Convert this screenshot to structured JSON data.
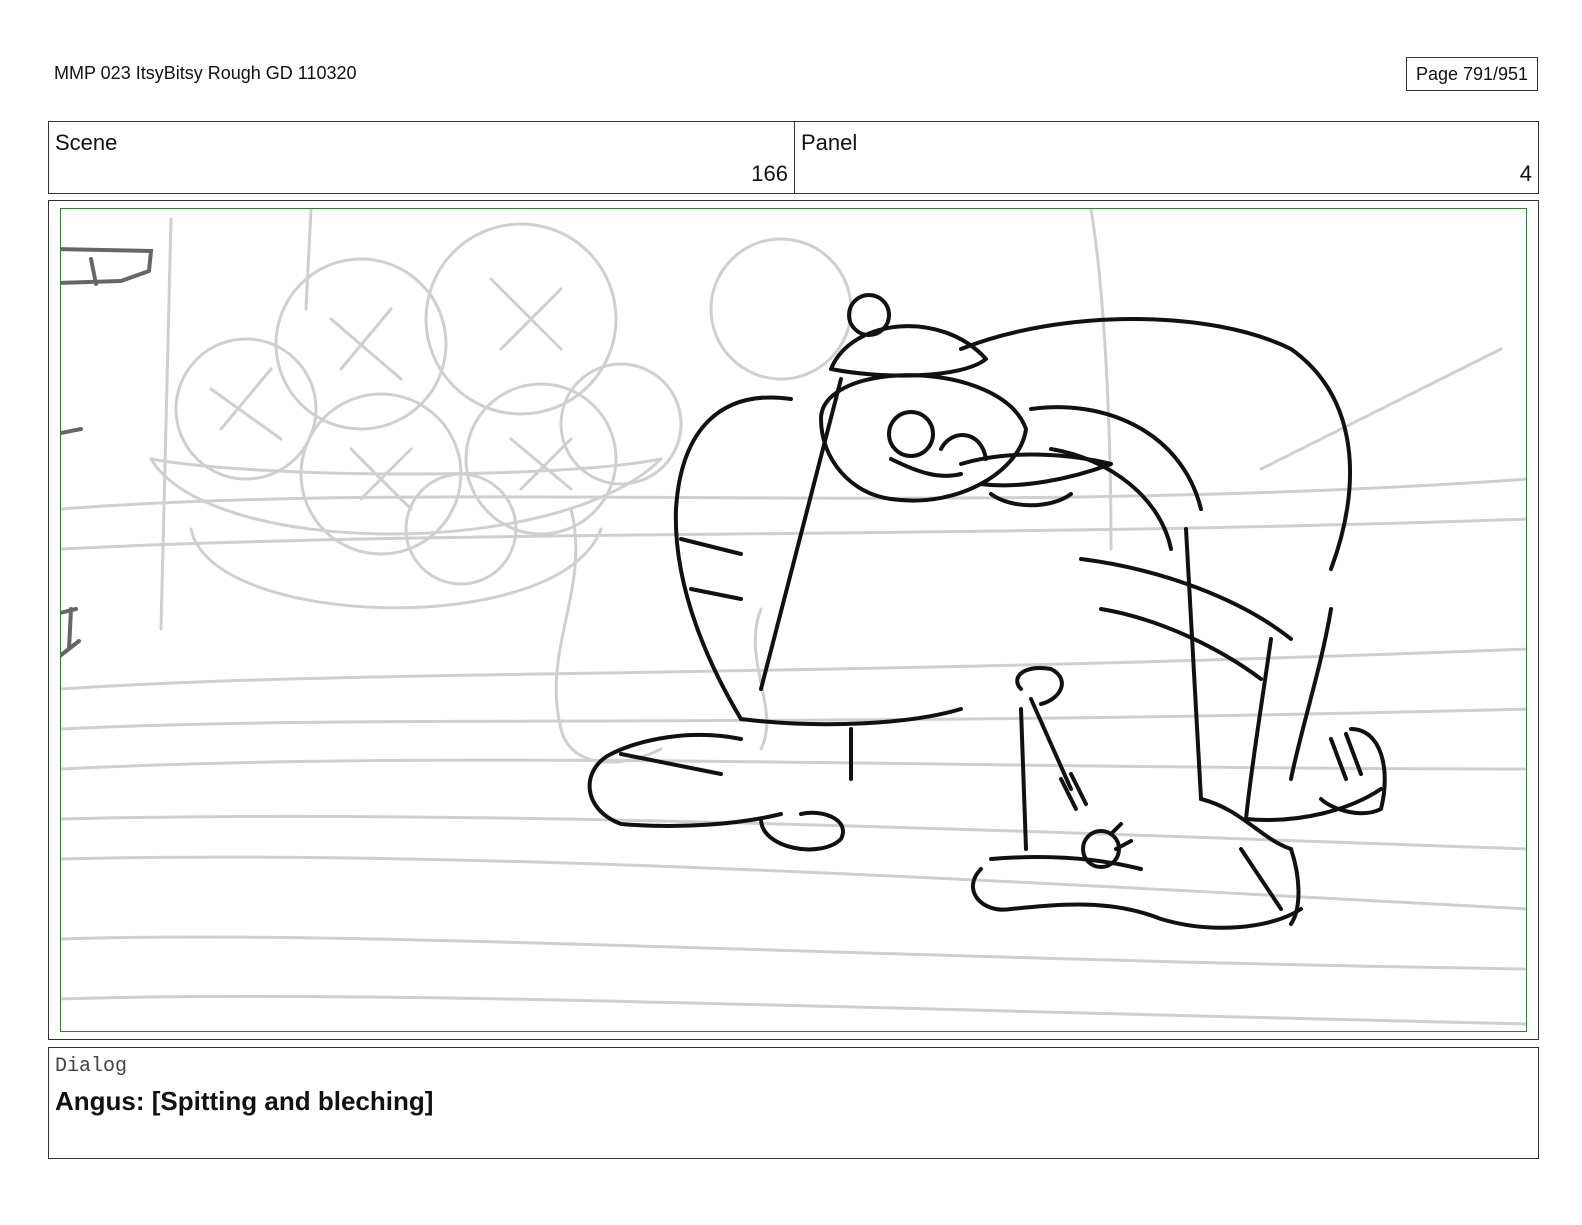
{
  "header": {
    "document_title": "MMP 023 ItsyBitsy Rough GD 110320",
    "page_label": "Page 791/951"
  },
  "info": {
    "scene_label": "Scene",
    "scene_number": "166",
    "panel_label": "Panel",
    "panel_number": "4"
  },
  "dialog": {
    "label": "Dialog",
    "text": "Angus: [Spitting and bleching]"
  }
}
